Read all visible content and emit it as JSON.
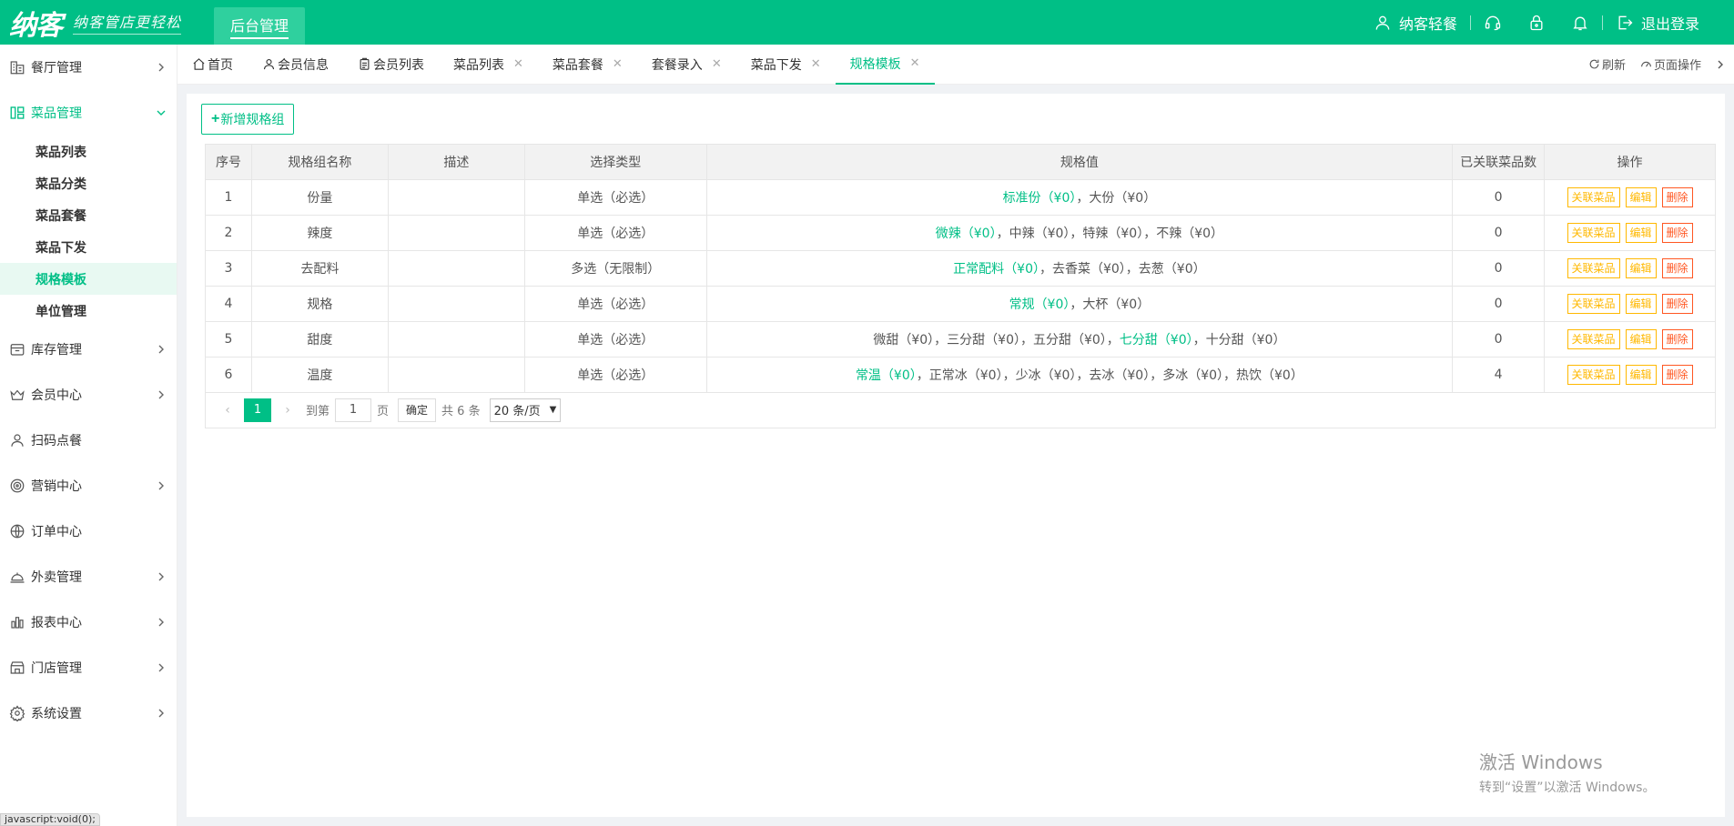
{
  "header": {
    "logo": "纳客",
    "slogan": "纳客管店更轻松",
    "admin_tab": "后台管理",
    "user": "纳客轻餐",
    "logout": "退出登录"
  },
  "sidebar": {
    "items": [
      {
        "label": "餐厅管理"
      },
      {
        "label": "菜品管理"
      },
      {
        "label": "库存管理"
      },
      {
        "label": "会员中心"
      },
      {
        "label": "扫码点餐"
      },
      {
        "label": "营销中心"
      },
      {
        "label": "订单中心"
      },
      {
        "label": "外卖管理"
      },
      {
        "label": "报表中心"
      },
      {
        "label": "门店管理"
      },
      {
        "label": "系统设置"
      }
    ],
    "sub_items": [
      "菜品列表",
      "菜品分类",
      "菜品套餐",
      "菜品下发",
      "规格模板",
      "单位管理"
    ],
    "status_tip": "javascript:void(0);"
  },
  "tabs": [
    {
      "label": "首页"
    },
    {
      "label": "会员信息"
    },
    {
      "label": "会员列表"
    },
    {
      "label": "菜品列表"
    },
    {
      "label": "菜品套餐"
    },
    {
      "label": "套餐录入"
    },
    {
      "label": "菜品下发"
    },
    {
      "label": "规格模板"
    }
  ],
  "tab_actions": {
    "refresh": "刷新",
    "page_ops": "页面操作"
  },
  "content": {
    "add_button": "新增规格组",
    "columns": [
      "序号",
      "规格组名称",
      "描述",
      "选择类型",
      "规格值",
      "已关联菜品数",
      "操作"
    ],
    "rows": [
      {
        "no": "1",
        "name": "份量",
        "desc": "",
        "type": "单选（必选）",
        "pre": "",
        "default": "标准份（¥0）",
        "post": "，大份（¥0）",
        "count": "0"
      },
      {
        "no": "2",
        "name": "辣度",
        "desc": "",
        "type": "单选（必选）",
        "pre": "",
        "default": "微辣（¥0）",
        "post": "，中辣（¥0），特辣（¥0），不辣（¥0）",
        "count": "0"
      },
      {
        "no": "3",
        "name": "去配料",
        "desc": "",
        "type": "多选（无限制）",
        "pre": "",
        "default": "正常配料（¥0）",
        "post": "，去香菜（¥0），去葱（¥0）",
        "count": "0"
      },
      {
        "no": "4",
        "name": "规格",
        "desc": "",
        "type": "单选（必选）",
        "pre": "",
        "default": "常规（¥0）",
        "post": "，大杯（¥0）",
        "count": "0"
      },
      {
        "no": "5",
        "name": "甜度",
        "desc": "",
        "type": "单选（必选）",
        "pre": "微甜（¥0），三分甜（¥0），五分甜（¥0），",
        "default": "七分甜（¥0）",
        "post": "，十分甜（¥0）",
        "count": "0"
      },
      {
        "no": "6",
        "name": "温度",
        "desc": "",
        "type": "单选（必选）",
        "pre": "",
        "default": "常温（¥0）",
        "post": "，正常冰（¥0），少冰（¥0），去冰（¥0），多冰（¥0），热饮（¥0）",
        "count": "4"
      }
    ],
    "ops": {
      "link": "关联菜品",
      "edit": "编辑",
      "delete": "删除"
    }
  },
  "pager": {
    "current": "1",
    "goto": "到第",
    "page_input": "1",
    "page_unit": "页",
    "confirm": "确定",
    "total": "共 6 条",
    "page_size": "20 条/页"
  },
  "watermark": {
    "line1": "激活 Windows",
    "line2": "转到“设置”以激活 Windows。"
  },
  "colors": {
    "brand": "#00bf86",
    "warning": "#ffb800",
    "danger": "#ff5722"
  }
}
